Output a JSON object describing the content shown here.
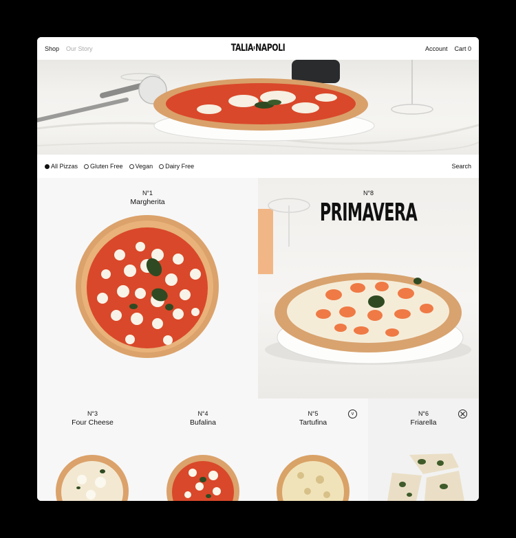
{
  "header": {
    "nav_left": [
      "Shop",
      "Our Story"
    ],
    "logo_left": "TALIA",
    "logo_right": "NAPOLI",
    "account_label": "Account",
    "cart_label": "Cart 0"
  },
  "filters": {
    "options": [
      {
        "label": "All Pizzas",
        "selected": true
      },
      {
        "label": "Gluten Free",
        "selected": false
      },
      {
        "label": "Vegan",
        "selected": false
      },
      {
        "label": "Dairy Free",
        "selected": false
      }
    ],
    "search_label": "Search"
  },
  "products": [
    {
      "number": "N°1",
      "name": "Margherita"
    },
    {
      "number": "N°8",
      "name": "PRIMAVERA"
    },
    {
      "number": "N°3",
      "name": "Four Cheese"
    },
    {
      "number": "N°4",
      "name": "Bufalina"
    },
    {
      "number": "N°5",
      "name": "Tartufina",
      "icon": "v"
    },
    {
      "number": "N°6",
      "name": "Friarella"
    }
  ],
  "colors": {
    "page_background": "#000000",
    "card_background": "#f7f7f7",
    "sauce": "#d9482a",
    "crust": "#dba26b",
    "basil": "#2f4a22"
  }
}
